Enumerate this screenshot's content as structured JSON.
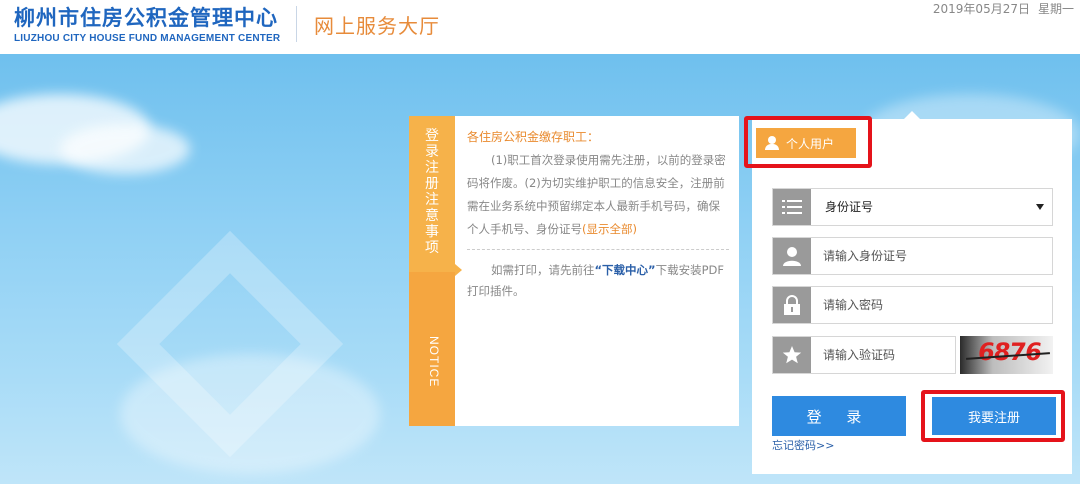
{
  "header": {
    "logo_cn": "柳州市住房公积金管理中心",
    "logo_en": "LIUZHOU CITY HOUSE FUND MANAGEMENT CENTER",
    "hall_title": "网上服务大厅",
    "date": "2019年05月27日",
    "weekday": "星期一"
  },
  "notice": {
    "tab_title": "登录注册注意事项",
    "tab_en": "NOTICE",
    "heading": "各住房公积金缴存职工：",
    "paragraph1": "(1)职工首次登录使用需先注册，以前的登录密码将作废。(2)为切实维护职工的信息安全，注册前需在业务系统中预留绑定本人最新手机号码，确保个人手机号、身份证号",
    "show_all": "(显示全部)",
    "paragraph2_pre": "如需打印，请先前往",
    "download_link": "“下载中心”",
    "paragraph2_post": "下载安装PDF打印插件。"
  },
  "login": {
    "user_tab": "个人用户",
    "id_type": "身份证号",
    "id_placeholder": "请输入身份证号",
    "password_placeholder": "请输入密码",
    "captcha_placeholder": "请输入验证码",
    "captcha_code": "6876",
    "login_button": "登 录",
    "register_button": "我要注册",
    "forgot_password": "忘记密码>>"
  },
  "colors": {
    "brand_blue": "#1f66bf",
    "accent_orange": "#f5a640",
    "button_blue": "#2e8ae0",
    "highlight_red": "#e5131a"
  }
}
